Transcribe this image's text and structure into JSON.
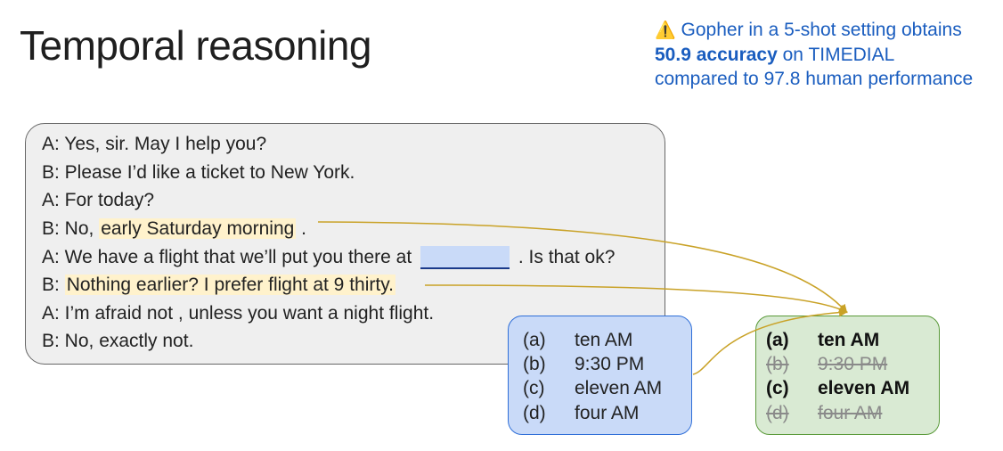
{
  "title": "Temporal reasoning",
  "note": {
    "icon": "warning-icon",
    "line1": "Gopher in a 5-shot setting obtains",
    "accuracy": "50.9 accuracy",
    "line2_rest": " on TIMEDIAL",
    "line3": "compared to 97.8 human performance"
  },
  "dialog": {
    "l1": "A: Yes, sir. May I help you?",
    "l2": "B: Please I’d like a ticket to New York.",
    "l3": "A: For today?",
    "l4_pre": "B: No, ",
    "l4_hl": "early Saturday morning",
    "l4_post": " .",
    "l5_pre": "A: We have a flight that we’ll put you there at ",
    "l5_post": " . Is that ok?",
    "l6_pre": "B: ",
    "l6_hl": "Nothing earlier? I prefer flight at 9 thirty.",
    "l7": "A: I’m afraid not , unless you want a night flight.",
    "l8": "B: No, exactly not."
  },
  "options": [
    {
      "letter": "(a)",
      "text": "ten AM"
    },
    {
      "letter": "(b)",
      "text": "9:30 PM"
    },
    {
      "letter": "(c)",
      "text": "eleven AM"
    },
    {
      "letter": "(d)",
      "text": "four AM"
    }
  ],
  "answers": [
    {
      "letter": "(a)",
      "text": "ten AM",
      "correct": true
    },
    {
      "letter": "(b)",
      "text": "9:30 PM",
      "correct": false
    },
    {
      "letter": "(c)",
      "text": "eleven AM",
      "correct": true
    },
    {
      "letter": "(d)",
      "text": "four AM",
      "correct": false
    }
  ],
  "colors": {
    "highlight": "#fff2cc",
    "arrow": "#c9a227",
    "options_bg": "#c9daf8",
    "answers_bg": "#d9ead3",
    "note_text": "#1a5dbf"
  }
}
